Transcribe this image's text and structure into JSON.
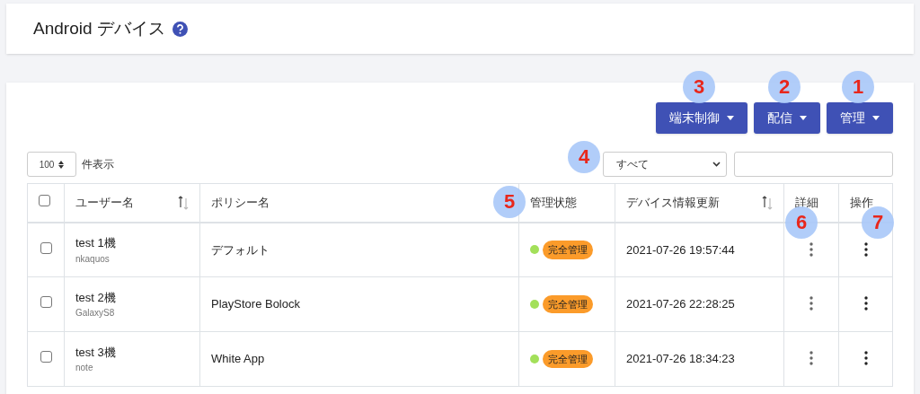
{
  "page_title": "Android デバイス",
  "action_buttons": [
    {
      "label": "端末制御"
    },
    {
      "label": "配信"
    },
    {
      "label": "管理"
    }
  ],
  "page_length": {
    "value": "100",
    "label": "件表示"
  },
  "filter": {
    "value": "すべて"
  },
  "table": {
    "columns": [
      {
        "kind": "checkbox",
        "checked": false
      },
      {
        "kind": "text",
        "label": "ユーザー名",
        "sortable": true
      },
      {
        "kind": "text",
        "label": "ポリシー名",
        "sortable": false
      },
      {
        "kind": "text",
        "label": "管理状態",
        "sortable": false
      },
      {
        "kind": "text",
        "label": "デバイス情報更新",
        "sortable": true
      },
      {
        "kind": "text",
        "label": "詳細",
        "sortable": false
      },
      {
        "kind": "text",
        "label": "操作",
        "sortable": false
      }
    ],
    "rows": [
      {
        "checked": false,
        "user": "test 1機",
        "device": "nkaquos",
        "policy": "デフォルト",
        "color": "#a3e05a",
        "status": "完全管理",
        "updated": "2021-07-26 19:57:44"
      },
      {
        "checked": false,
        "user": "test 2機",
        "device": "GalaxyS8",
        "policy": "PlayStore Bolock",
        "color": "#a3e05a",
        "status": "完全管理",
        "updated": "2021-07-26 22:28:25"
      },
      {
        "checked": false,
        "user": "test 3機",
        "device": "note",
        "policy": "White App",
        "color": "#a3e05a",
        "status": "完全管理",
        "updated": "2021-07-26 18:34:23"
      }
    ]
  },
  "callouts": [
    {
      "label": "3"
    },
    {
      "label": "2"
    },
    {
      "label": "1"
    },
    {
      "label": "4"
    },
    {
      "label": "5"
    },
    {
      "label": "6"
    },
    {
      "label": "7"
    }
  ]
}
